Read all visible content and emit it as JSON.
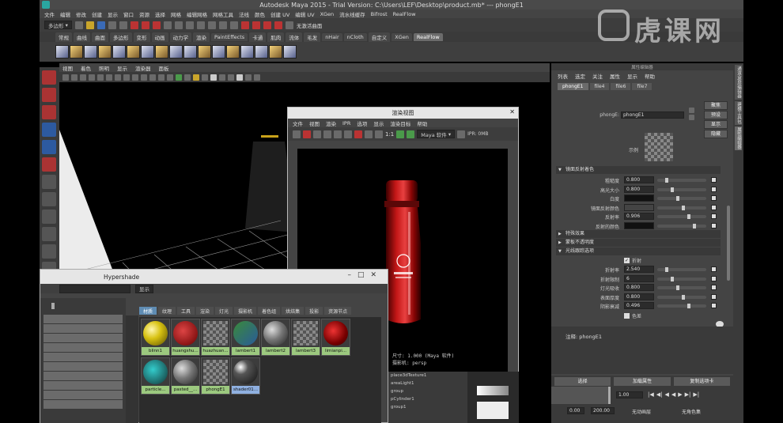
{
  "window": {
    "title": "Autodesk Maya 2015 - Trial Version: C:\\Users\\LEF\\Desktop\\product.mb* --- phongE1"
  },
  "menubar": {
    "items": [
      "文件",
      "编辑",
      "修改",
      "创建",
      "显示",
      "窗口",
      "资源",
      "选择",
      "网格",
      "编辑网格",
      "网格工具",
      "法线",
      "颜色",
      "创建 UV",
      "编辑 UV",
      "XGen",
      "流水线缓存",
      "Bifrost",
      "RealFlow"
    ]
  },
  "statusline": {
    "mode": "多边形",
    "live_label": "无激活曲面"
  },
  "shelf": {
    "tabs": [
      "常规",
      "曲线",
      "曲面",
      "多边形",
      "变形",
      "动画",
      "动力学",
      "渲染",
      "PaintEffects",
      "卡通",
      "肌肉",
      "流体",
      "毛发",
      "nHair",
      "nCloth",
      "自定义",
      "XGen",
      "RealFlow"
    ],
    "active_tab": "RealFlow"
  },
  "viewport": {
    "menu": [
      "视图",
      "着色",
      "照明",
      "显示",
      "渲染器",
      "面板"
    ]
  },
  "render_view": {
    "title": "渲染视图",
    "menu": [
      "文件",
      "视图",
      "渲染",
      "IPR",
      "选项",
      "显示",
      "渲染目标",
      "帮助"
    ],
    "ratio": "1:1",
    "renderer": "Maya 软件",
    "ipr_label": "IPR: 0MB",
    "info_line1": "尺寸: 1.000     (Maya 软件)",
    "info_line2": "摄影机: persp"
  },
  "hypershade": {
    "title": "Hypershade",
    "search_btn": "显示",
    "tabs": [
      "材质",
      "纹理",
      "工具",
      "渲染",
      "灯光",
      "摄影机",
      "着色组",
      "烘焙集",
      "投影",
      "资源节点"
    ],
    "active_tab": "材质",
    "swatches": [
      {
        "label": "blinn1",
        "icon": "yellow-sphere-icon"
      },
      {
        "label": "huangshu...",
        "icon": "red-checker-sphere-icon"
      },
      {
        "label": "huazhuan...",
        "icon": "checker-swatch-icon"
      },
      {
        "label": "lambert1",
        "icon": "green-checker-icon"
      },
      {
        "label": "lambert2",
        "icon": "grey-sphere-icon"
      },
      {
        "label": "lambert3",
        "icon": "checker-swatch-icon"
      },
      {
        "label": "limianpi...",
        "icon": "red-sphere-icon"
      },
      {
        "label": "particle...",
        "icon": "teal-checker-icon"
      },
      {
        "label": "pasted__...",
        "icon": "grey-sphere-icon"
      },
      {
        "label": "phongE1",
        "icon": "checker-swatch-icon"
      },
      {
        "label": "shader01...",
        "icon": "glossy-sphere-icon"
      }
    ]
  },
  "outliner": {
    "items": [
      "place3dTexture1",
      "areaLight1",
      "group",
      "pCylinder1",
      "group1"
    ]
  },
  "attribute_editor": {
    "title": "属性编辑器",
    "menu": [
      "列表",
      "选定",
      "关注",
      "属性",
      "显示",
      "帮助"
    ],
    "tabs": [
      "phongE1",
      "file4",
      "file6",
      "file7"
    ],
    "active_tab": "phongE1",
    "node_label": "phongE:",
    "node_value": "phongE1",
    "side_buttons": [
      "聚焦",
      "预设",
      "显示",
      "隐藏"
    ],
    "sample_label": "示例",
    "section_specular": "镜面反射着色",
    "specular": [
      {
        "label": "粗糙度",
        "value": "0.800"
      },
      {
        "label": "高光大小",
        "value": "0.800"
      },
      {
        "label": "白度",
        "value": ""
      },
      {
        "label": "镜面反射颜色",
        "value": ""
      },
      {
        "label": "反射率",
        "value": "0.906"
      },
      {
        "label": "反射的颜色",
        "value": ""
      }
    ],
    "section_special": "特殊效果",
    "section_matte": "蒙板不透明度",
    "section_raytrace": "光线跟踪选项",
    "refraction_check": "折射",
    "raytrace": [
      {
        "label": "折射率",
        "value": "2.540"
      },
      {
        "label": "折射限制",
        "value": "6"
      },
      {
        "label": "灯光吸收",
        "value": "0.800"
      },
      {
        "label": "表面厚度",
        "value": "0.800"
      },
      {
        "label": "阴影衰减",
        "value": "0.496"
      }
    ],
    "chromatic_check": "色差",
    "notes_label": "注释: phongE1",
    "bottom_buttons": [
      "选择",
      "加载属性",
      "复制选项卡"
    ]
  },
  "timeline": {
    "start": "1.00",
    "range_start": "0.00",
    "range_end": "200.00",
    "anim_layer": "无动画层",
    "char_set": "无角色集"
  },
  "right_strip": {
    "tabs": [
      "通道盒/层编辑器",
      "建模工具包",
      "属性编辑器"
    ]
  },
  "watermark": {
    "text": "虎课网"
  }
}
